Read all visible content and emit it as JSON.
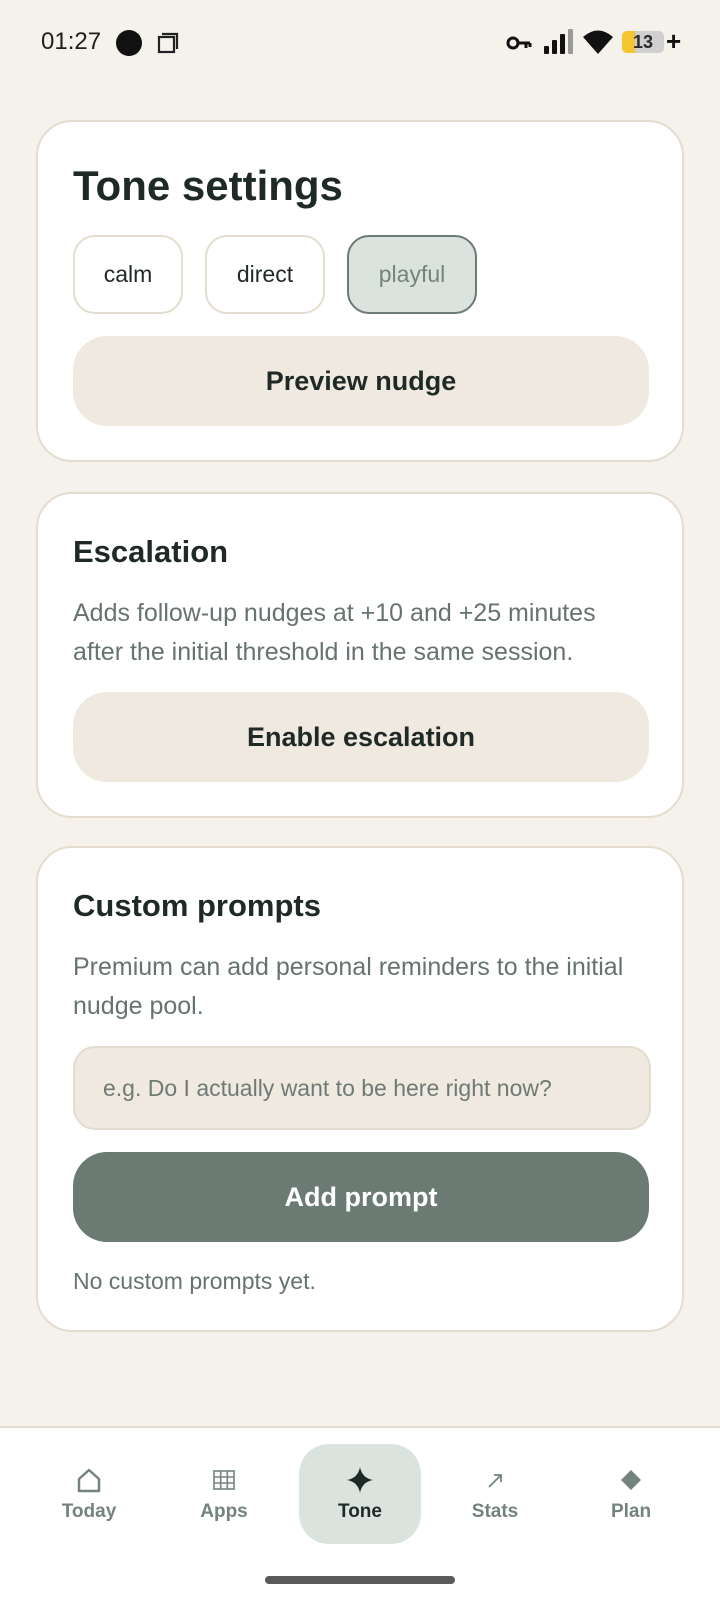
{
  "status_bar": {
    "time": "01:27",
    "battery_level": "13",
    "battery_fraction": 0.3
  },
  "tone_card": {
    "title": "Tone settings",
    "chips": [
      {
        "label": "calm",
        "selected": false
      },
      {
        "label": "direct",
        "selected": false
      },
      {
        "label": "playful",
        "selected": true
      }
    ],
    "preview_button": "Preview nudge"
  },
  "escalation_card": {
    "title": "Escalation",
    "description": "Adds follow-up nudges at +10 and +25 minutes after the initial threshold in the same session.",
    "button": "Enable escalation"
  },
  "custom_prompts_card": {
    "title": "Custom prompts",
    "description": "Premium can add personal reminders to the initial nudge pool.",
    "input_placeholder": "e.g. Do I actually want to be here right now?",
    "input_value": "",
    "add_button": "Add prompt",
    "empty_note": "No custom prompts yet."
  },
  "bottom_nav": {
    "items": [
      {
        "label": "Today",
        "icon": "home-icon",
        "active": false
      },
      {
        "label": "Apps",
        "icon": "grid-icon",
        "active": false
      },
      {
        "label": "Tone",
        "icon": "sparkle-icon",
        "active": true
      },
      {
        "label": "Stats",
        "icon": "arrow-up-right-icon",
        "active": false
      },
      {
        "label": "Plan",
        "icon": "diamond-icon",
        "active": false
      }
    ]
  },
  "colors": {
    "background": "#f5f2ec",
    "accent": "#6b7b74",
    "selected_chip_bg": "#dbe3de",
    "card_border": "#e4ddcf"
  }
}
